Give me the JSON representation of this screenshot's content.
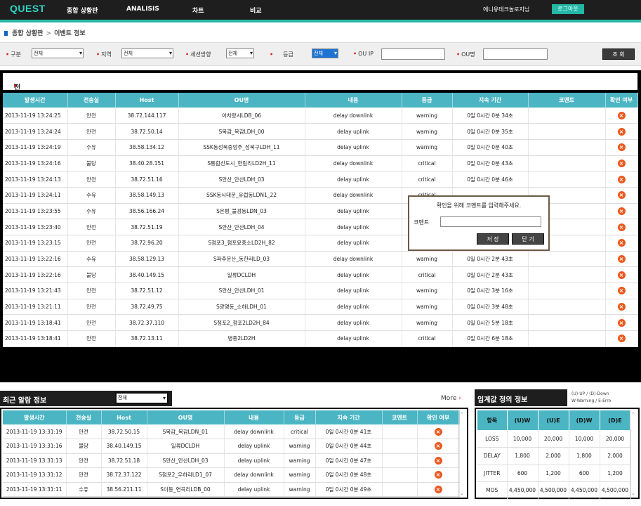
{
  "header": {
    "logo": "QUEST",
    "nav": [
      "종합 상황판",
      "ANALISIS",
      "차트",
      "비교"
    ],
    "user": "에니유테크놀로지님",
    "logout": "로그아웃"
  },
  "breadcrumb": {
    "root": "종합 상황판",
    "sep": ">",
    "current": "이벤트 정보"
  },
  "filters": {
    "type_label": "구분",
    "type_value": "전체",
    "region_label": "지역",
    "region_value": "전체",
    "session_label": "세션방향",
    "session_value": "전체",
    "level_label": "등급",
    "level_value": "전체",
    "ou_ip_label": "OU IP",
    "ou_name_label": "OU명",
    "search_button": "조 회"
  },
  "main": {
    "title": "전체",
    "columns": [
      "발생시간",
      "전송실",
      "Host",
      "OU명",
      "내용",
      "등급",
      "지속 기간",
      "코멘트",
      "확인 여부"
    ],
    "rows": [
      [
        "2013-11-19 13:24:25",
        "안전",
        "38.72.144.117",
        "아차량시LDB_06",
        "delay downlink",
        "warning",
        "0일 0시간 0분 34초",
        ""
      ],
      [
        "2013-11-19 13:24:24",
        "안전",
        "38.72.50.14",
        "S목감_목감LDH_00",
        "delay uplink",
        "warning",
        "0일 0시간 0분 35초",
        ""
      ],
      [
        "2013-11-19 13:24:19",
        "수유",
        "38.58.134.12",
        "SSK동성북중앙주_성북구LDH_11",
        "delay uplink",
        "warning",
        "0일 0시간 0분 40초",
        ""
      ],
      [
        "2013-11-19 13:24:16",
        "불당",
        "38.40.28.151",
        "S통합신도시_한림리LD2H_11",
        "delay downlink",
        "critical",
        "0일 0시간 0분 43초",
        ""
      ],
      [
        "2013-11-19 13:24:13",
        "안전",
        "38.72.51.16",
        "S안산_안산LDH_03",
        "delay uplink",
        "critical",
        "0일 0시간 0분 46초",
        ""
      ],
      [
        "2013-11-19 13:24:11",
        "수유",
        "38.58.149.13",
        "SSK동시대문_유럽동LDN1_22",
        "delay downlink",
        "critical",
        "",
        ""
      ],
      [
        "2013-11-19 13:23:55",
        "수유",
        "38.56.166.24",
        "S은평_불광동LDN_03",
        "delay uplink",
        "",
        "",
        ""
      ],
      [
        "2013-11-19 13:23:40",
        "안전",
        "38.72.51.19",
        "S안산_안산LDH_04",
        "delay uplink",
        "",
        "",
        ""
      ],
      [
        "2013-11-19 13:23:15",
        "안전",
        "38.72.96.20",
        "S점포3_점포묘중소LD2H_82",
        "delay uplink",
        "",
        "",
        ""
      ],
      [
        "2013-11-19 13:22:16",
        "수유",
        "38.58.129.13",
        "S파주문산_동한리LD_03",
        "delay downlink",
        "warning",
        "0일 0시간 2분 43초",
        ""
      ],
      [
        "2013-11-19 13:22:16",
        "불당",
        "38.40.149.15",
        "일류DCLDH",
        "delay uplink",
        "critical",
        "0일 0시간 2분 43초",
        ""
      ],
      [
        "2013-11-19 13:21:43",
        "안전",
        "38.72.51.12",
        "S안산_안산LDH_01",
        "delay uplink",
        "warning",
        "0일 0시간 3분 16초",
        ""
      ],
      [
        "2013-11-19 13:21:11",
        "안전",
        "38.72.49.75",
        "S광명동_소하LDH_01",
        "delay uplink",
        "warning",
        "0일 0시간 3분 48초",
        ""
      ],
      [
        "2013-11-19 13:18:41",
        "안전",
        "38.72.37.110",
        "S점포2_점포2LD2H_84",
        "delay uplink",
        "warning",
        "0일 0시간 5분 18초",
        ""
      ],
      [
        "2013-11-19 13:18:41",
        "안전",
        "38.72.13.11",
        "병종2LD2H",
        "delay uplink",
        "critical",
        "0일 0시간 6분 18초",
        ""
      ]
    ],
    "confirm_icon": "x-circle-icon"
  },
  "popup": {
    "title": "확인을 위해 코멘트를 입력해주세요.",
    "label": "코멘트",
    "save": "저 장",
    "close": "닫 기"
  },
  "recent": {
    "title": "최근 알람 정보",
    "select_value": "전체",
    "more": "More",
    "columns": [
      "발생시간",
      "전송실",
      "Host",
      "OU명",
      "내용",
      "등급",
      "지속 기간",
      "코멘트",
      "확인 여부"
    ],
    "rows": [
      [
        "2013-11-19 13:31:19",
        "안전",
        "38.72.50.15",
        "S목감_목감LDN_01",
        "delay downlink",
        "critical",
        "0일 0시간 0분 41초",
        ""
      ],
      [
        "2013-11-19 13:31:16",
        "불당",
        "38.40.149.15",
        "일류DCLDH",
        "delay uplink",
        "warning",
        "0일 0시간 0분 44초",
        ""
      ],
      [
        "2013-11-19 13:31:13",
        "안전",
        "38.72.51.18",
        "S안산_안산LDH_03",
        "delay uplink",
        "warning",
        "0일 0시간 0분 47초",
        ""
      ],
      [
        "2013-11-19 13:31:12",
        "안전",
        "38.72.37.122",
        "S점포2_우하리LD1_07",
        "delay downlink",
        "warning",
        "0일 0시간 0분 48초",
        ""
      ],
      [
        "2013-11-19 13:31:11",
        "수유",
        "38.56.211.11",
        "S이동_연곡리LDB_00",
        "delay uplink",
        "warning",
        "0일 0시간 0분 49초",
        ""
      ]
    ]
  },
  "threshold": {
    "title": "임계값 정의 정보",
    "legend_line1": "(U)-UP / (D)-Down",
    "legend_line2": "W-Warning / E-Erro",
    "columns": [
      "항목",
      "(U)W",
      "(U)E",
      "(D)W",
      "(D)E"
    ],
    "rows": [
      [
        "LOSS",
        "10,000",
        "20,000",
        "10,000",
        "20,000"
      ],
      [
        "DELAY",
        "1,800",
        "2,000",
        "1,800",
        "2,000"
      ],
      [
        "JITTER",
        "600",
        "1,200",
        "600",
        "1,200"
      ],
      [
        "MOS",
        "4,450,000",
        "4,500,000",
        "4,450,000",
        "4,500,000"
      ]
    ]
  },
  "colors": {
    "accent": "#2bb8a8",
    "table_header": "#4bb5c3",
    "icon": "#ea5a1f",
    "selected": "#1e73d2"
  }
}
